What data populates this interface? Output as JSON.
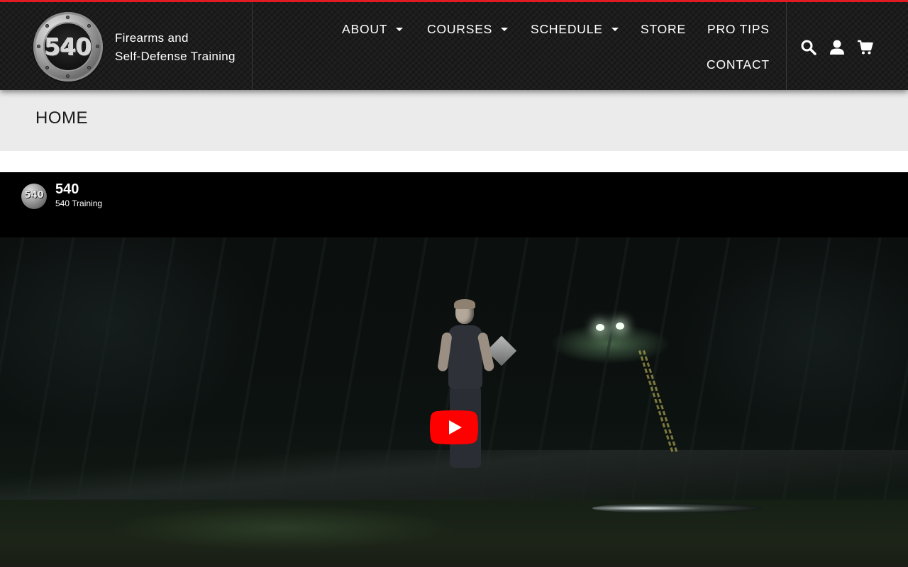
{
  "brand": {
    "logo_text": "540",
    "tagline_line1": "Firearms and",
    "tagline_line2": "Self-Defense Training"
  },
  "nav": {
    "items": [
      {
        "label": "ABOUT",
        "has_dropdown": true
      },
      {
        "label": "COURSES",
        "has_dropdown": true
      },
      {
        "label": "SCHEDULE",
        "has_dropdown": true
      },
      {
        "label": "STORE",
        "has_dropdown": false
      },
      {
        "label": "PRO TIPS",
        "has_dropdown": false
      },
      {
        "label": "CONTACT",
        "has_dropdown": false
      }
    ]
  },
  "header_icons": [
    "search-icon",
    "user-icon",
    "cart-icon"
  ],
  "breadcrumb": {
    "current": "HOME"
  },
  "video": {
    "channel_logo_text": "540",
    "channel_title": "540",
    "channel_subtitle": "540 Training",
    "play_button_color": "#ff0000"
  },
  "colors": {
    "accent": "#e01b24",
    "header_bg": "#1c1c1c",
    "subbar_bg": "#ebebeb"
  }
}
